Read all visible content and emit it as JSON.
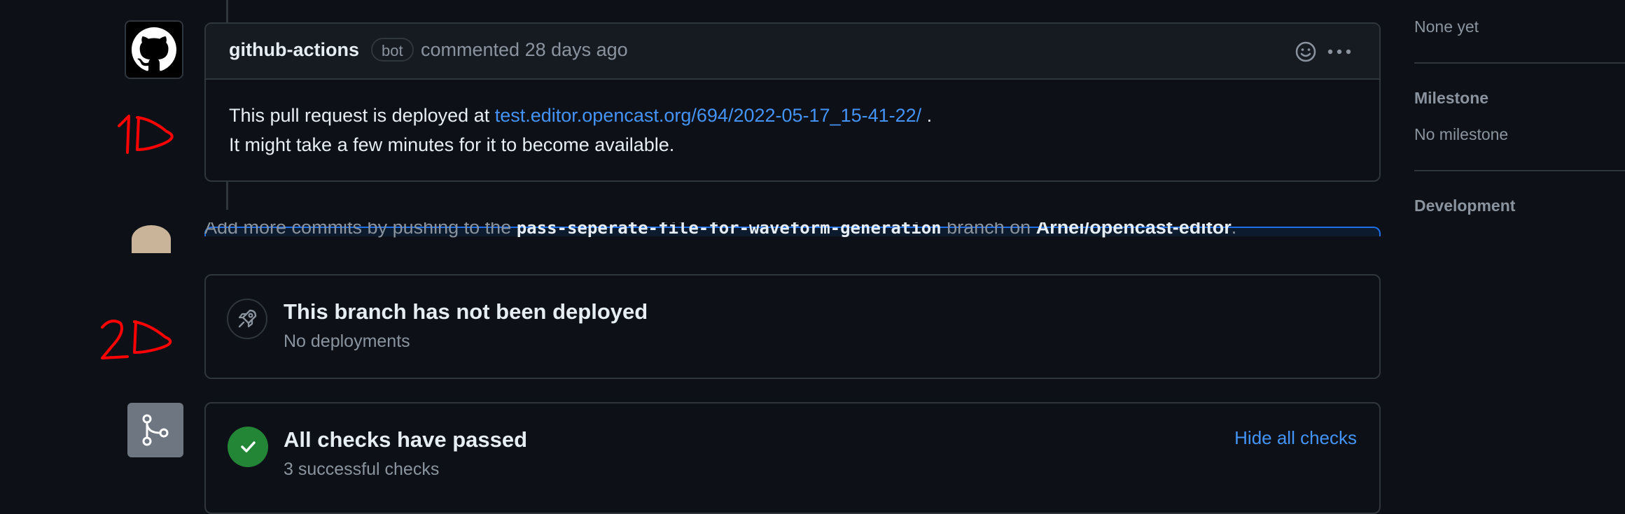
{
  "comment": {
    "author": "github-actions",
    "badge": "bot",
    "meta": "commented 28 days ago",
    "body_line1_prefix": "This pull request is deployed at ",
    "body_link": "test.editor.opencast.org/694/2022-05-17_15-41-22/",
    "body_line1_suffix": " .",
    "body_line2": "It might take a few minutes for it to become available."
  },
  "merge_hint": {
    "prefix": "Add more commits by pushing to the ",
    "branch": "pass-seperate-file-for-waveform-generation",
    "middle": " branch on ",
    "repo": "Arnei/opencast-editor",
    "suffix": "."
  },
  "deployment": {
    "title": "This branch has not been deployed",
    "subtitle": "No deployments"
  },
  "checks": {
    "title": "All checks have passed",
    "subtitle": "3 successful checks",
    "toggle_label": "Hide all checks"
  },
  "sidebar": {
    "reviewers_value": "None yet",
    "milestone_heading": "Milestone",
    "milestone_value": "No milestone",
    "development_heading": "Development"
  },
  "colors": {
    "background": "#0d1117",
    "border": "#30363d",
    "link": "#4493f8",
    "success": "#238636",
    "annotation": "#ff0000"
  }
}
